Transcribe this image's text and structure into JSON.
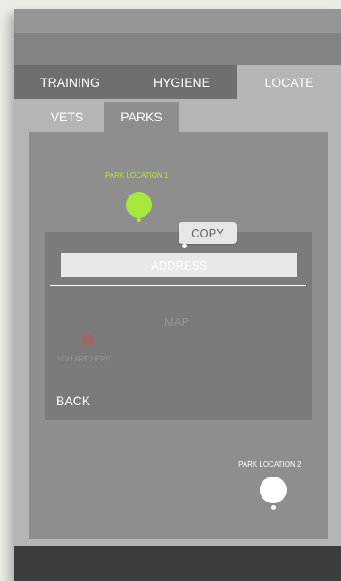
{
  "tabs": [
    {
      "label": "TRAINING"
    },
    {
      "label": "HYGIENE"
    },
    {
      "label": "LOCATE",
      "active": true
    }
  ],
  "subtabs": [
    {
      "label": "VETS"
    },
    {
      "label": "PARKS",
      "active": true
    }
  ],
  "map": {
    "park1": {
      "label": "PARK LOCATION 1",
      "color": "#a6e83e"
    },
    "park2": {
      "label": "PARK LOCATION 2",
      "color": "#ffffff"
    },
    "copy_label": "COPY",
    "address_placeholder": "ADDRESS",
    "map_label": "MAP",
    "you_are_here": "YOU ARE HERE",
    "back_label": "BACK"
  },
  "colors": {
    "accent_green": "#a6e83e",
    "you_marker": "#9a6a6a"
  }
}
